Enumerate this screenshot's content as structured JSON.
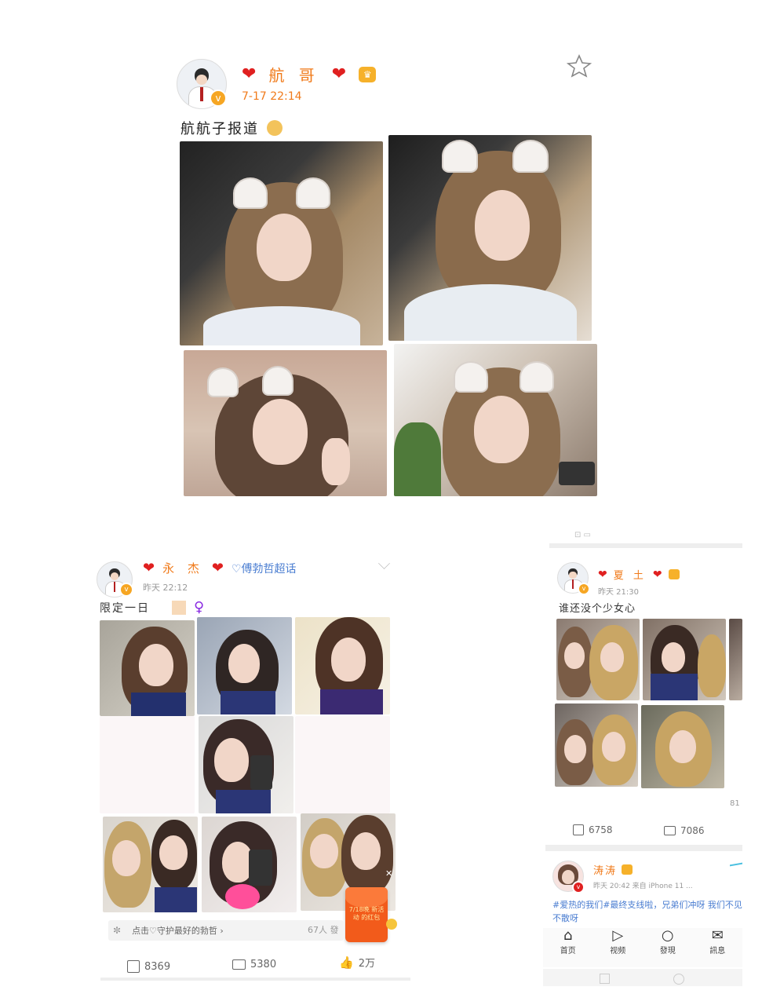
{
  "post1": {
    "heart_left": "❤",
    "name": "航 哥",
    "heart_right": "❤",
    "time": "7-17 22:14",
    "text": "航航子报道",
    "star_icon": "star-icon"
  },
  "post2": {
    "name": "永 杰",
    "supertopic": "♡傅勃哲超话",
    "time": "昨天 22:12",
    "text": "限定一日",
    "female_symbol": "♀",
    "footer_hint": "点击♡守护最好的勃哲 ›",
    "footer_count": "67人 發",
    "red_packet": "7/18晚 新活动 的红包",
    "repost_count": "8369",
    "comment_count": "5380",
    "like_count": "2万"
  },
  "post3": {
    "name": "夏 土",
    "time": "昨天 21:30",
    "text": "谁还没个少女心",
    "repost_count": "6758",
    "comment_count": "7086",
    "side_count": "81"
  },
  "post4": {
    "name": "涛涛",
    "time": "昨天 20:42 来自 iPhone 11 ...",
    "text": "#爱热的我们#最终支线啦，兄弟们冲呀 我们不见不散呀"
  },
  "tabbar": {
    "items": [
      "首页",
      "视频",
      "發現",
      "訊息"
    ]
  },
  "colors": {
    "accent": "#f07a1a",
    "heart": "#e02020",
    "badge": "#f6a623",
    "link": "#4a7dd1"
  }
}
